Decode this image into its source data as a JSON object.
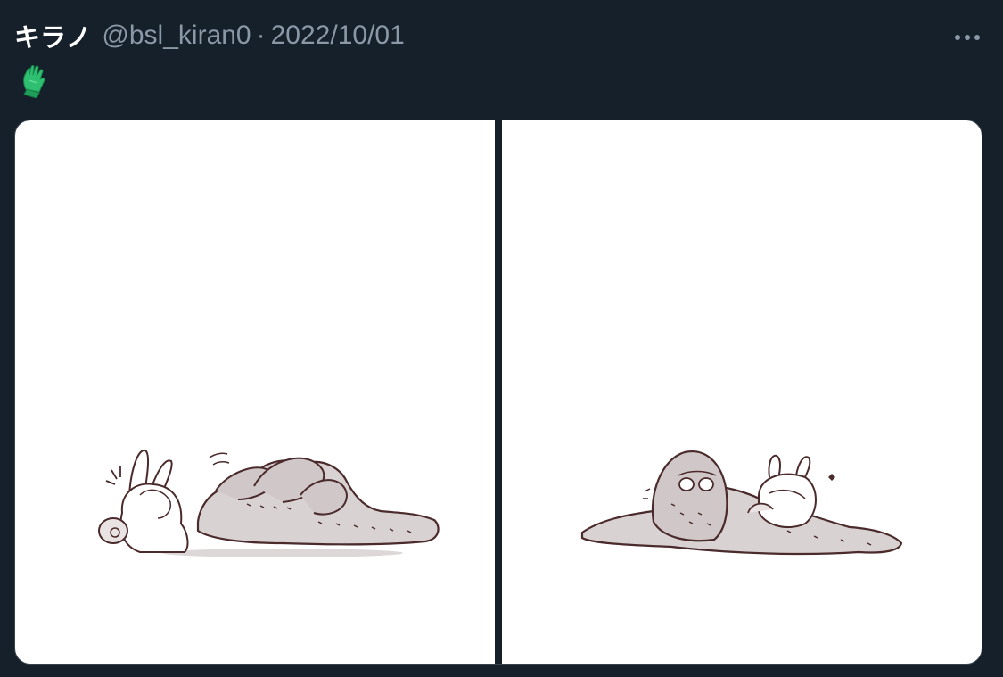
{
  "tweet": {
    "display_name": "キラノ",
    "handle": "@bsl_kiran0",
    "separator": "·",
    "date": "2022/10/01",
    "body_emoji": "gloves-emoji",
    "more_icon": "more-horizontal-icon"
  },
  "media": [
    {
      "type": "illustration"
    },
    {
      "type": "illustration"
    }
  ],
  "colors": {
    "background": "#15202b",
    "name": "#ffffff",
    "secondary": "#8b98a5",
    "glove": "#2fbf71"
  }
}
